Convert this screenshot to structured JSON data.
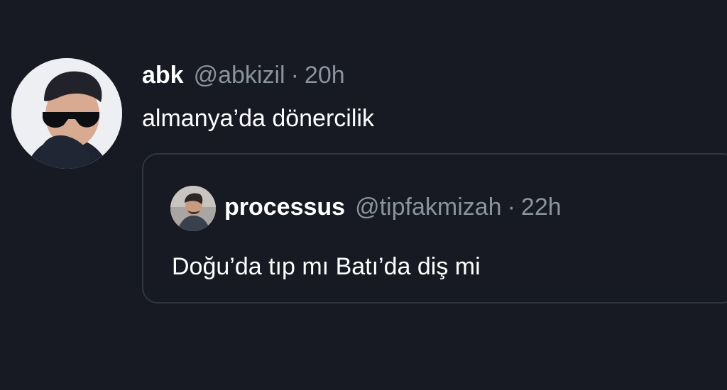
{
  "tweet": {
    "author": {
      "display_name": "abk",
      "handle": "@abkizil",
      "avatar_icon": "user-avatar-sunglasses"
    },
    "separator": "·",
    "time": "20h",
    "text": "almanya’da dönercilik"
  },
  "quoted_tweet": {
    "author": {
      "display_name": "processus",
      "handle": "@tipfakmizah",
      "avatar_icon": "user-avatar"
    },
    "separator": "·",
    "time": "22h",
    "text": "Doğu’da tıp mı Batı’da diş mi"
  },
  "colors": {
    "background": "#171a23",
    "text_primary": "#ffffff",
    "text_secondary": "#8a939e",
    "card_border": "#30363f"
  }
}
